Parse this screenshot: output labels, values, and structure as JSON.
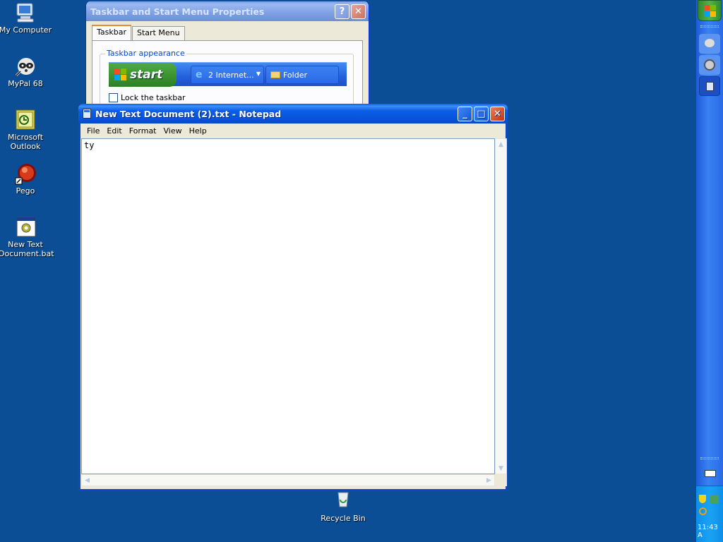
{
  "desktop": {
    "icons": [
      {
        "label": "My Computer",
        "icon": "computer-icon"
      },
      {
        "label": "MyPal 68",
        "icon": "raccoon-icon"
      },
      {
        "label": "Microsoft\nOutlook",
        "icon": "outlook-icon"
      },
      {
        "label": "Pego",
        "icon": "red-orb-icon"
      },
      {
        "label": "New Text\nDocument.bat",
        "icon": "batch-file-icon"
      },
      {
        "label": "Recycle Bin",
        "icon": "recycle-bin-icon"
      }
    ]
  },
  "properties_dialog": {
    "title": "Taskbar and Start Menu Properties",
    "tabs": [
      "Taskbar",
      "Start Menu"
    ],
    "active_tab": "Taskbar",
    "group_label": "Taskbar appearance",
    "preview": {
      "start_label": "start",
      "task1": "2 Internet...",
      "task2": "Folder"
    },
    "lock_checkbox": {
      "label": "Lock the taskbar",
      "checked": false
    }
  },
  "notepad": {
    "title": "New Text Document (2).txt - Notepad",
    "menu": [
      "File",
      "Edit",
      "Format",
      "View",
      "Help"
    ],
    "content": "ty"
  },
  "taskbar": {
    "clock": "11:43 A"
  },
  "colors": {
    "desktop": "#0b4e96",
    "title_active": "#0553d8",
    "start_green": "#39922e"
  }
}
